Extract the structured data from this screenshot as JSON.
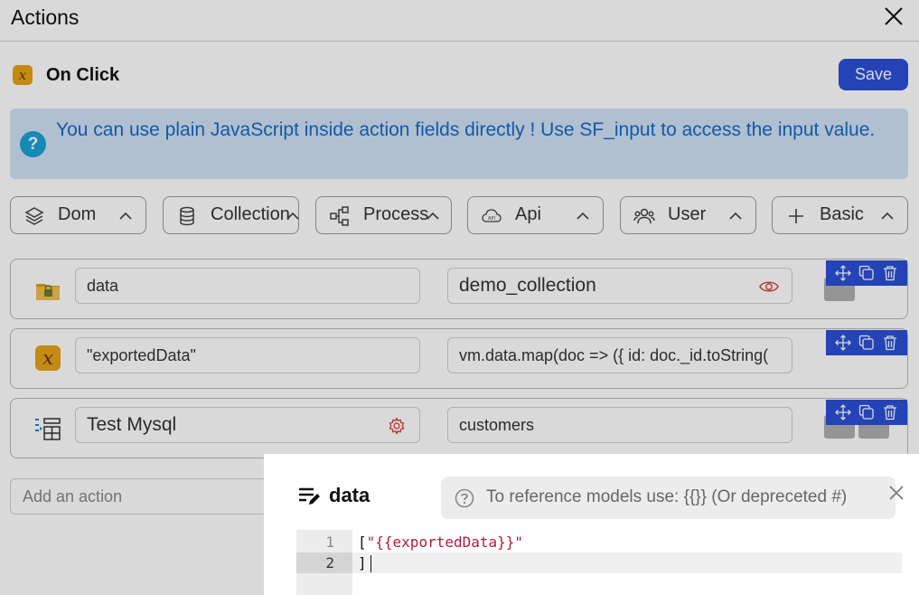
{
  "header": {
    "title": "Actions"
  },
  "trigger": {
    "label": "On Click"
  },
  "toolbar": {
    "save_label": "Save"
  },
  "info": {
    "text": "You can use plain JavaScript inside action fields directly ! Use SF_input to access the input value."
  },
  "categories": [
    {
      "label": "Dom",
      "icon": "layers-icon"
    },
    {
      "label": "Collection",
      "icon": "database-icon"
    },
    {
      "label": "Process",
      "icon": "process-icon"
    },
    {
      "label": "Api",
      "icon": "cloud-api-icon"
    },
    {
      "label": "User",
      "icon": "users-icon"
    },
    {
      "label": "Basic",
      "icon": "plus-icon"
    }
  ],
  "actions": [
    {
      "icon": "folder-lock-icon",
      "field1": "data",
      "field2": "demo_collection",
      "field2_icon": "eye-icon"
    },
    {
      "icon": "variable-icon",
      "field1": "\"exportedData\"",
      "field2": "vm.data.map(doc => ({ id: doc._id.toString("
    },
    {
      "icon": "table-icon",
      "field1": "Test Mysql",
      "field1_icon": "gear-icon",
      "field2": "customers"
    }
  ],
  "add_action": {
    "placeholder": "Add an action"
  },
  "modal": {
    "title": "data",
    "hint": "To reference models use: {{}} (Or depreceted #)",
    "code_lines": [
      {
        "number": "1",
        "open": "[",
        "string": "\"{{exportedData}}\""
      },
      {
        "number": "2",
        "close": "]"
      }
    ]
  },
  "colors": {
    "accent": "#2b4fd6",
    "info_bg": "#cfe2f5",
    "info_text": "#1769c4",
    "string": "#b11a40"
  }
}
